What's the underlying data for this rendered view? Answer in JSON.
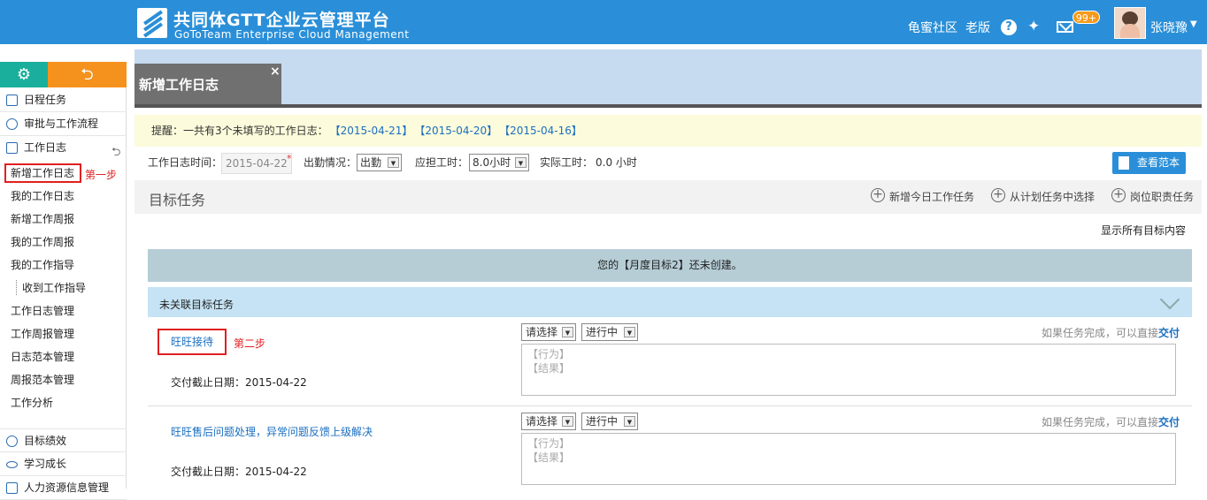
{
  "header": {
    "brand_title": "共同体GTT企业云管理平台",
    "brand_subtitle": "GoToTeam Enterprise Cloud Management",
    "links": [
      "龟蜜社区",
      "老版"
    ],
    "mail_badge": "99+",
    "user_name": "张晓豫"
  },
  "sidebar": {
    "groups": [
      {
        "label": "日程任务",
        "icon": "calendar-icon"
      },
      {
        "label": "审批与工作流程",
        "icon": "person-icon"
      },
      {
        "label": "工作日志",
        "icon": "edit-icon"
      },
      {
        "label": "目标绩效",
        "icon": "target-icon"
      },
      {
        "label": "学习成长",
        "icon": "glasses-icon"
      },
      {
        "label": "人力资源信息管理",
        "icon": "people-icon"
      }
    ],
    "log_items": [
      "新增工作日志",
      "我的工作日志",
      "新增工作周报",
      "我的工作周报",
      "我的工作指导",
      "收到工作指导",
      "工作日志管理",
      "工作周报管理",
      "日志范本管理",
      "周报范本管理",
      "工作分析"
    ]
  },
  "tab": {
    "label": "新增工作日志",
    "close": "×"
  },
  "reminder": {
    "text": "提醒：一共有3个未填写的工作日志：",
    "dates": [
      "【2015-04-21】",
      "【2015-04-20】",
      "【2015-04-16】"
    ]
  },
  "form": {
    "date_label": "工作日志时间：",
    "date_value": "2015-04-22",
    "attendance_label": "出勤情况：",
    "attendance_value": "出勤",
    "hours_label": "应担工时：",
    "hours_value": "8.0小时",
    "actual_label": "实际工时：",
    "actual_value": "0.0 小时",
    "view_sample": "查看范本"
  },
  "targets": {
    "title": "目标任务",
    "actions": [
      "新增今日工作任务",
      "从计划任务中选择",
      "岗位职责任务"
    ],
    "show_all": "显示所有目标内容",
    "notice": "您的【月度目标2】还未创建。",
    "unlinked_title": "未关联目标任务"
  },
  "tasks": [
    {
      "name": "旺旺接待",
      "due": "交付截止日期：2015-04-22",
      "select": "请选择",
      "status": "进行中",
      "hint": "如果任务完成，可以直接",
      "hint_link": "交付",
      "placeholder_action": "【行为】",
      "placeholder_result": "【结果】"
    },
    {
      "name": "旺旺售后问题处理，异常问题反馈上级解决",
      "due": "交付截止日期：2015-04-22",
      "select": "请选择",
      "status": "进行中",
      "hint": "如果任务完成，可以直接",
      "hint_link": "交付",
      "placeholder_action": "【行为】",
      "placeholder_result": "【结果】"
    }
  ],
  "annotations": {
    "step1": "第一步",
    "step2": "第二步"
  }
}
